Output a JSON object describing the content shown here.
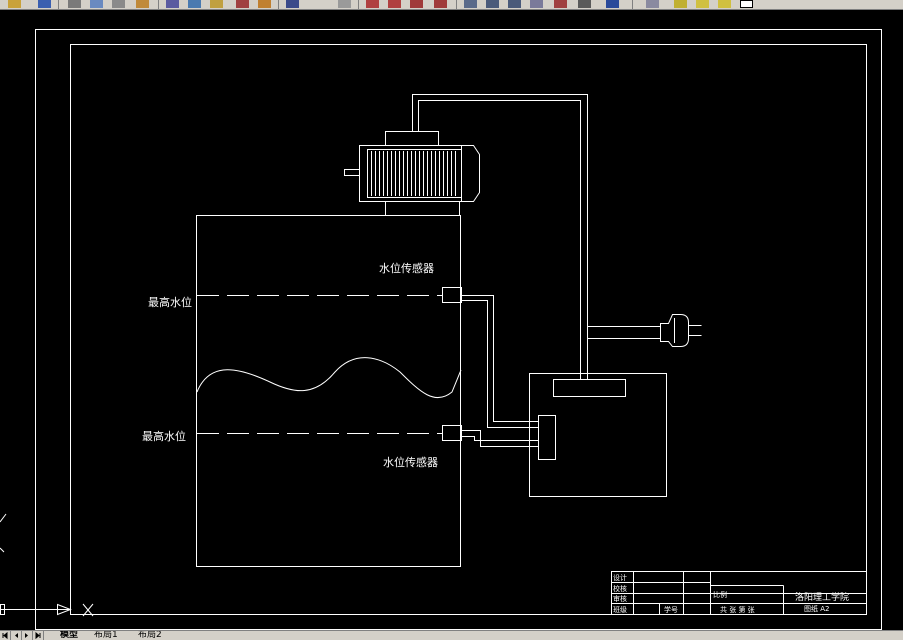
{
  "drawing": {
    "label_top_sensor": "水位传感器",
    "label_bottom_sensor": "水位传感器",
    "label_high_level": "最高水位",
    "label_low_level": "最高水位"
  },
  "title_block": {
    "row_design": "设计",
    "row_check": "校核",
    "row_review": "审核",
    "row_class": "班级",
    "row_number": "学号",
    "scale_label": "比例",
    "sheets": "共 张 第 张",
    "school": "洛阳理工学院",
    "paper": "图纸 A2"
  },
  "tabs": [
    {
      "label": "模型"
    },
    {
      "label": "布局1"
    },
    {
      "label": "布局2"
    }
  ],
  "colors": {
    "background": "#000000",
    "lines": "#ffffff",
    "ui_gray": "#d4d0c8"
  }
}
